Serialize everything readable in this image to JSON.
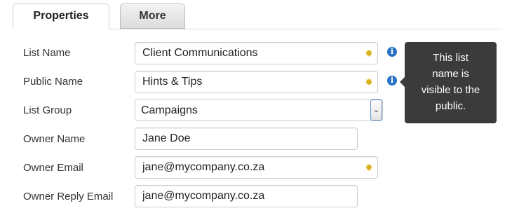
{
  "tabs": [
    {
      "label": "Properties",
      "active": true
    },
    {
      "label": "More",
      "active": false
    }
  ],
  "form": {
    "list_name": {
      "label": "List Name",
      "value": "Client Communications",
      "icons": [
        "gear-icon",
        "info-icon"
      ]
    },
    "public_name": {
      "label": "Public Name",
      "value": "Hints & Tips",
      "icons": [
        "gear-icon",
        "info-icon"
      ]
    },
    "list_group": {
      "label": "List Group",
      "value": "Campaigns",
      "icons": [
        "chevron-down-icon"
      ]
    },
    "owner_name": {
      "label": "Owner Name",
      "value": "Jane Doe"
    },
    "owner_email": {
      "label": "Owner Email",
      "value": "jane@mycompany.co.za",
      "icons": [
        "gear-icon"
      ]
    },
    "owner_reply_email": {
      "label": "Owner Reply Email",
      "value": "jane@mycompany.co.za"
    }
  },
  "tooltip": {
    "lines": [
      "This list",
      "name is",
      "visible to the",
      "public."
    ]
  },
  "colors": {
    "tooltip_bg": "#3b3b3b",
    "info_icon": "#2a72c4",
    "gear_icon": "#d8b31a"
  }
}
